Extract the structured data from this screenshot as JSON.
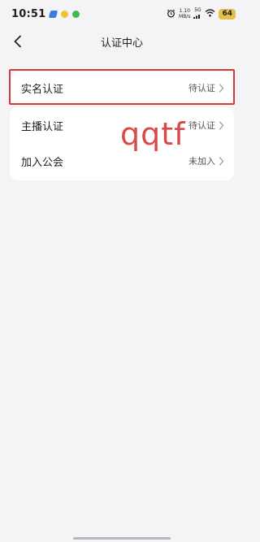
{
  "status_bar": {
    "time": "10:51",
    "net_speed_value": "1.10",
    "net_speed_unit": "MB/s",
    "network": "5G",
    "battery": "64"
  },
  "header": {
    "title": "认证中心",
    "back_icon": "chevron-left-icon"
  },
  "items": [
    {
      "label": "实名认证",
      "status": "待认证"
    },
    {
      "label": "主播认证",
      "status": "待认证"
    },
    {
      "label": "加入公会",
      "status": "未加入"
    }
  ],
  "watermark": "qqtf",
  "colors": {
    "background": "#f4f4f6",
    "card": "#ffffff",
    "highlight": "#d63b3b",
    "battery": "#e0c248"
  }
}
